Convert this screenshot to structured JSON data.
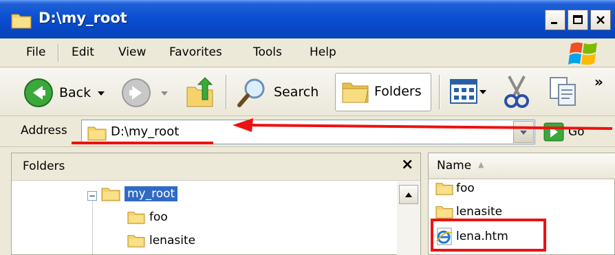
{
  "window": {
    "title": "D:\\my_root",
    "minimize_glyph": "_",
    "maximize_glyph": "□",
    "close_glyph": "✕"
  },
  "menu": {
    "items": [
      "File",
      "Edit",
      "View",
      "Favorites",
      "Tools",
      "Help"
    ]
  },
  "toolbar": {
    "back_label": "Back",
    "search_label": "Search",
    "folders_label": "Folders",
    "overflow_glyph": "»"
  },
  "address": {
    "label": "Address",
    "value": "D:\\my_root",
    "go_label": "Go"
  },
  "folders_pane": {
    "title": "Folders",
    "close_glyph": "×",
    "tree": [
      {
        "label": "my_root",
        "selected": true
      },
      {
        "label": "foo",
        "selected": false
      },
      {
        "label": "lenasite",
        "selected": false
      }
    ],
    "toggle_glyph": "−"
  },
  "files_pane": {
    "column_name": "Name",
    "sort_glyph": "▲",
    "items": [
      {
        "label": "foo",
        "type": "folder"
      },
      {
        "label": "lenasite",
        "type": "folder"
      },
      {
        "label": "lena.htm",
        "type": "html-file"
      }
    ]
  },
  "colors": {
    "titlebar": "#0a4fd0",
    "selection": "#316ac5",
    "annotation": "#ee1111"
  }
}
